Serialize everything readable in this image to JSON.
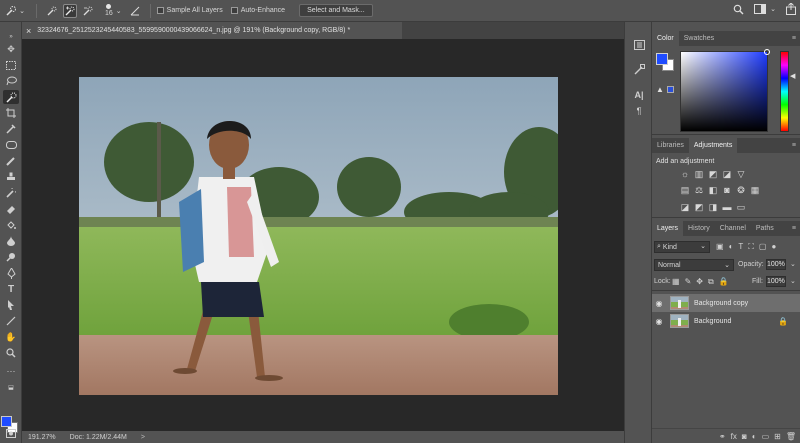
{
  "options_bar": {
    "tool_icon": "quick-selection-icon",
    "brush_size": "16",
    "sample_all_layers": "Sample All Layers",
    "sample_all_layers_checked": false,
    "auto_enhance": "Auto-Enhance",
    "auto_enhance_checked": false,
    "select_and_mask": "Select and Mask..."
  },
  "document": {
    "tab_title": "32324676_2512523245440583_5599590000439066624_n.jpg @ 191% (Background copy, RGB/8) *",
    "close_glyph": "×"
  },
  "status": {
    "zoom": "191.27%",
    "doc_size": "Doc: 1.22M/2.44M",
    "arrow": ">"
  },
  "panels": {
    "color_tabs": [
      "Color",
      "Swatches"
    ],
    "adjust_tabs": [
      "Libraries",
      "Adjustments"
    ],
    "add_adjustment": "Add an adjustment",
    "layer_tabs": [
      "Layers",
      "History",
      "Channel",
      "Paths"
    ],
    "kind": "Kind",
    "blend_mode": "Normal",
    "opacity_label": "Opacity:",
    "opacity_value": "100%",
    "lock_label": "Lock:",
    "fill_label": "Fill:",
    "fill_value": "100%"
  },
  "layers": [
    {
      "name": "Background copy",
      "selected": true,
      "locked": false
    },
    {
      "name": "Background",
      "selected": false,
      "locked": true
    }
  ],
  "colors": {
    "foreground": "#1f4cff",
    "background": "#ffffff",
    "canvas_bg": "#282828",
    "ui_gray": "#535353"
  }
}
